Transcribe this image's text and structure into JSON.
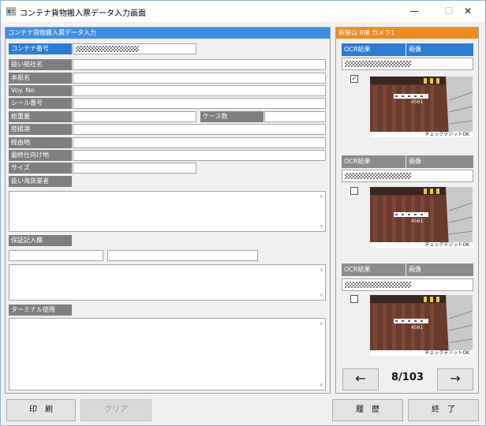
{
  "window": {
    "title": "コンテナ貨物搬入票データ入力画面",
    "minimize": "—",
    "maximize": "☐",
    "close": "✕"
  },
  "form": {
    "header": "コンテナ貨物搬入票データ入力",
    "fields": {
      "container_no": "コンテナ番号",
      "shipping_company": "扱い船社名",
      "vessel_name": "本船名",
      "voy_no": "Voy. No.",
      "seal_no": "シール番号",
      "gross_weight": "総重量",
      "case_count": "ケース数",
      "port_of_loading": "陸揚港",
      "via": "経由地",
      "final_destination": "最終仕向け地",
      "size": "サイズ",
      "handler": "扱い海貨業者",
      "guarantee_note": "保証記入欄",
      "terminal_use": "ターミナル使用"
    }
  },
  "camera_panel": {
    "header": "新狭山 8棟 カメラ1",
    "entries": [
      {
        "ocr_label": "OCR結果",
        "image_label": "画像",
        "checked": true,
        "check_mark": "✓",
        "caption": "チェックデジットOK",
        "code": "4561"
      },
      {
        "ocr_label": "OCR結果",
        "image_label": "画像",
        "checked": false,
        "check_mark": "",
        "caption": "チェックデジットOK",
        "code": "4561"
      },
      {
        "ocr_label": "OCR結果",
        "image_label": "画像",
        "checked": false,
        "check_mark": "",
        "caption": "チェックデジットOK",
        "code": "4561"
      }
    ],
    "prev": "←",
    "next": "→",
    "pager": "8/103"
  },
  "buttons": {
    "print": "印　刷",
    "clear": "クリア",
    "history": "履　歴",
    "exit": "終　了"
  },
  "colors": {
    "accent_blue": "#3d8fe6",
    "label_gray": "#7f7f7f",
    "camera_header_orange": "#f08c1d"
  }
}
